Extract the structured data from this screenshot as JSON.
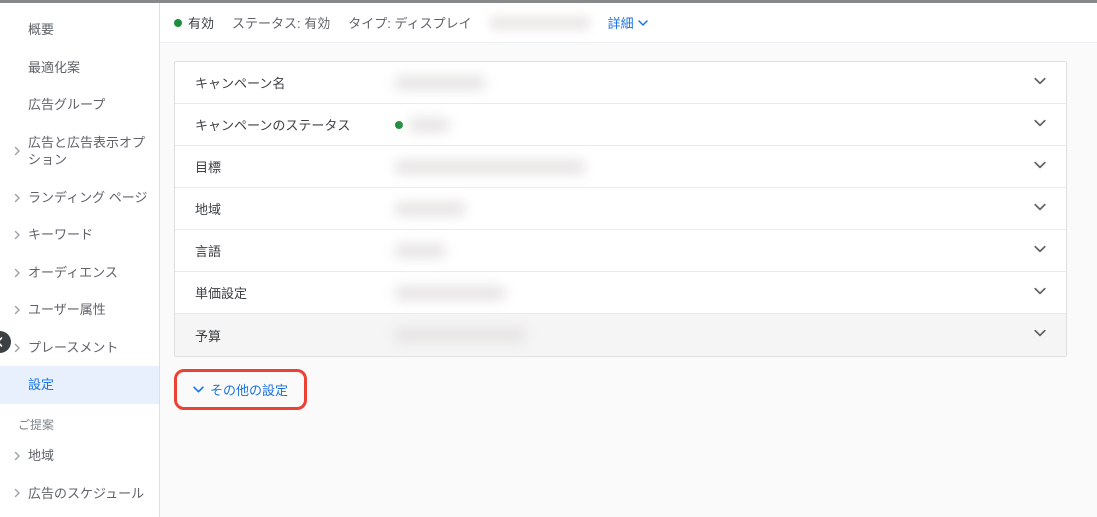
{
  "sidebar": {
    "items": [
      {
        "label": "概要",
        "hasArrow": false
      },
      {
        "label": "最適化案",
        "hasArrow": false
      },
      {
        "label": "広告グループ",
        "hasArrow": false
      },
      {
        "label": "広告と広告表示オプション",
        "hasArrow": true
      },
      {
        "label": "ランディング ページ",
        "hasArrow": true
      },
      {
        "label": "キーワード",
        "hasArrow": true
      },
      {
        "label": "オーディエンス",
        "hasArrow": true
      },
      {
        "label": "ユーザー属性",
        "hasArrow": true
      },
      {
        "label": "プレースメント",
        "hasArrow": true
      },
      {
        "label": "設定",
        "hasArrow": false,
        "active": true
      }
    ],
    "section_label": "ご提案",
    "sub_items": [
      {
        "label": "地域",
        "hasArrow": true
      },
      {
        "label": "広告のスケジュール",
        "hasArrow": true
      }
    ]
  },
  "statusbar": {
    "enabled_label": "有効",
    "status_label": "ステータス: 有効",
    "type_label": "タイプ: ディスプレイ",
    "details_label": "詳細"
  },
  "settings": {
    "rows": [
      {
        "label": "キャンペーン名",
        "blur_w": 90
      },
      {
        "label": "キャンペーンのステータス",
        "blur_w": 40,
        "green_dot": true
      },
      {
        "label": "目標",
        "blur_w": 190
      },
      {
        "label": "地域",
        "blur_w": 70
      },
      {
        "label": "言語",
        "blur_w": 50
      },
      {
        "label": "単価設定",
        "blur_w": 110
      },
      {
        "label": "予算",
        "blur_w": 130,
        "alt": true
      }
    ]
  },
  "other_settings_label": "その他の設定"
}
